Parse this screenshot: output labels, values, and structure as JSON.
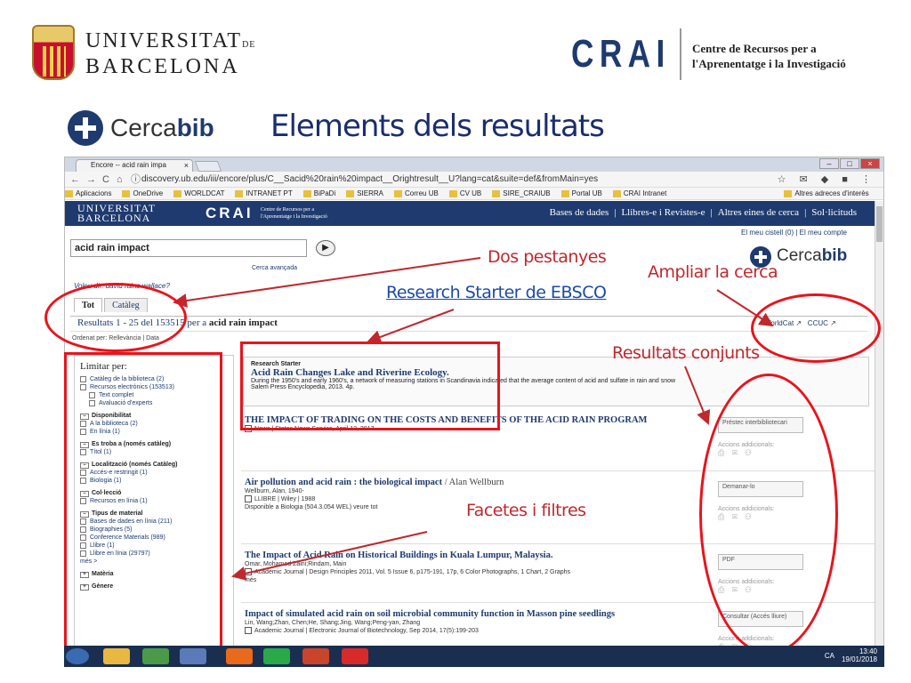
{
  "slide": {
    "ub_line1": "UNIVERSITAT",
    "ub_de": "DE",
    "ub_line2": "BARCELONA",
    "crai": "CRAI",
    "crai_desc_1": "Centre de Recursos per a",
    "crai_desc_2": "l'Aprenentatge i la Investigació",
    "cerca_pre": "Cerca",
    "cerca_post": "bib",
    "title": "Elements dels resultats"
  },
  "browser": {
    "tab_title": "Encore -- acid rain impa",
    "url": "discovery.ub.edu/iii/encore/plus/C__Sacid%20rain%20impact__Orightresult__U?lang=cat&suite=def&fromMain=yes",
    "bookmarks": [
      "Aplicacions",
      "OneDrive",
      "WORLDCAT",
      "INTRANET PT",
      "BiPaDi",
      "SIERRA",
      "Correu UB",
      "CV UB",
      "SIRE_CRAIUB",
      "Portal UB",
      "CRAI Intranet",
      "Altres adreces d'interès"
    ]
  },
  "site": {
    "ub1": "UNIVERSITAT",
    "ub2": "BARCELONA",
    "crai": "CRAI",
    "crai_desc_1": "Centre de Recursos per a",
    "crai_desc_2": "l'Aprenentatge i la Investigació",
    "nav": [
      "Bases de dades",
      "Llibres-e i Revistes-e",
      "Altres eines de cerca",
      "Sol·licituds"
    ],
    "account": "El meu cistell (0)  |  El meu compte",
    "search_value": "acid rain impact",
    "advanced": "Cerca avançada",
    "did_you_mean": "Voleu dir: david rains wallace?",
    "tab_all": "Tot",
    "tab_catalog": "Catàleg",
    "results_prefix": "Resultats 1 - 25 del 153515 per a",
    "results_query": "acid rain impact",
    "ext_worldcat": "WorldCat",
    "ext_ccuc": "CCUC",
    "sort": "Ordenat per: Rellevància | Data"
  },
  "sidebar": {
    "title": "Limitar per:",
    "items": [
      {
        "t": "Catàleg de la biblioteca (2)",
        "k": "item"
      },
      {
        "t": "Recursos electrònics (153513)",
        "k": "item"
      },
      {
        "t": "Text complet",
        "k": "sub"
      },
      {
        "t": "Avaluació d'experts",
        "k": "sub"
      },
      {
        "t": "Disponibilitat",
        "k": "sec"
      },
      {
        "t": "A la biblioteca (2)",
        "k": "item"
      },
      {
        "t": "En línia (1)",
        "k": "item"
      },
      {
        "t": "Es troba a (només catàleg)",
        "k": "sec"
      },
      {
        "t": "Títol (1)",
        "k": "item"
      },
      {
        "t": "Localització (només Catàleg)",
        "k": "sec"
      },
      {
        "t": "Accés-e restringit (1)",
        "k": "item"
      },
      {
        "t": "Biologia (1)",
        "k": "item"
      },
      {
        "t": "Col·lecció",
        "k": "sec"
      },
      {
        "t": "Recursos en línia (1)",
        "k": "item"
      },
      {
        "t": "Tipus de material",
        "k": "sec"
      },
      {
        "t": "Bases de dades en línia (211)",
        "k": "item"
      },
      {
        "t": "Biographies (5)",
        "k": "item"
      },
      {
        "t": "Conference Materials (989)",
        "k": "item"
      },
      {
        "t": "Llibre (1)",
        "k": "item"
      },
      {
        "t": "Llibre en línia (29797)",
        "k": "item"
      },
      {
        "t": "més >",
        "k": "more"
      },
      {
        "t": "Matèria",
        "k": "plus"
      },
      {
        "t": "Gènere",
        "k": "plus"
      }
    ]
  },
  "research_starter": {
    "label": "Research Starter",
    "title": "Acid Rain Changes Lake and Riverine Ecology.",
    "text": "During the 1950's and early 1960's, a network of measuring stations in Scandinavia indicated that the average content of acid and sulfate in rain and snow",
    "source": "Salem Press Encyclopedia, 2013. 4p."
  },
  "results": [
    {
      "title": "THE IMPACT OF TRADING ON THE COSTS AND BENEFITS OF THE ACID RAIN PROGRAM",
      "author": "",
      "meta": [
        "News  |  States News Service, April 12, 2017"
      ]
    },
    {
      "title": "Air pollution and acid rain : the biological impact",
      "author": "/ Alan Wellburn",
      "meta": [
        "Wellburn, Alan, 1940-",
        "LLIBRE  |  Wiley  |  1988",
        "Disponible a Biologia (504.3.054 WEL)  veure tot"
      ]
    },
    {
      "title": "The Impact of Acid Rain on Historical Buildings in Kuala Lumpur, Malaysia.",
      "author": "",
      "meta": [
        "Omar, Mohamed Zaini;Rindam, Main",
        "Academic Journal  |  Design Principles 2011, Vol. 5 Issue 6, p175-191, 17p, 6 Color Photographs, 1 Chart, 2 Graphs",
        "més"
      ]
    },
    {
      "title": "Impact of simulated acid rain on soil microbial community function in Masson pine seedlings",
      "author": "",
      "meta": [
        "Lin, Wang;Zhan, Chen;He, Shang;Jing, Wang;Peng-yan, Zhang",
        "Academic Journal  |  Electronic Journal of Biotechnology, Sep 2014, 17(5):199-203"
      ]
    }
  ],
  "actions": [
    {
      "button": "Préstec interbibliotecari",
      "label": "Accions addicionals:"
    },
    {
      "button": "Demanar-lo",
      "label": "Accions addicionals:"
    },
    {
      "button": "PDF",
      "label": "Accions addicionals:"
    },
    {
      "button": "Consultar (Accés lliure)",
      "label": "Accions addicionals:"
    }
  ],
  "annotations": {
    "tabs": "Dos pestanyes",
    "expand": "Ampliar la cerca",
    "starter": "Research Starter de EBSCO",
    "joint": "Resultats conjunts",
    "facets": "Facetes i filtres"
  },
  "taskbar": {
    "lang": "CA",
    "time": "13:40",
    "date": "19/01/2018"
  },
  "colors": {
    "annotation": "#e8141c",
    "brand": "#1e3a6e",
    "title": "#1a2d6e"
  }
}
